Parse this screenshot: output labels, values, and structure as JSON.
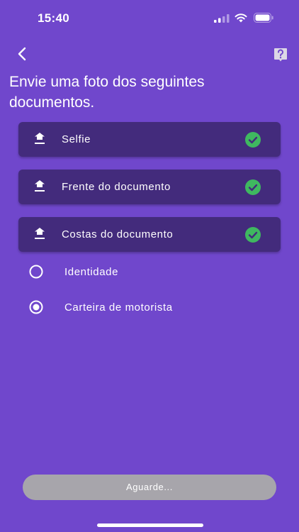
{
  "status_bar": {
    "time": "15:40"
  },
  "header": {
    "back_icon": "chevron-left-icon",
    "help_icon": "help-question-icon",
    "title": "Envie uma foto dos seguintes documentos."
  },
  "documents": [
    {
      "label": "Selfie",
      "icon": "upload-icon",
      "status_icon": "check-circle-icon",
      "done": true
    },
    {
      "label": "Frente do documento",
      "icon": "upload-icon",
      "status_icon": "check-circle-icon",
      "done": true
    },
    {
      "label": "Costas do documento",
      "icon": "upload-icon",
      "status_icon": "check-circle-icon",
      "done": true
    }
  ],
  "document_type": {
    "options": [
      {
        "label": "Identidade",
        "selected": false
      },
      {
        "label": "Carteira de motorista",
        "selected": true
      }
    ]
  },
  "footer": {
    "button_label": "Aguarde..."
  },
  "colors": {
    "background": "#7047cc",
    "card": "#432b7c",
    "success": "#3fb860",
    "button_disabled": "#a7a5ab"
  }
}
